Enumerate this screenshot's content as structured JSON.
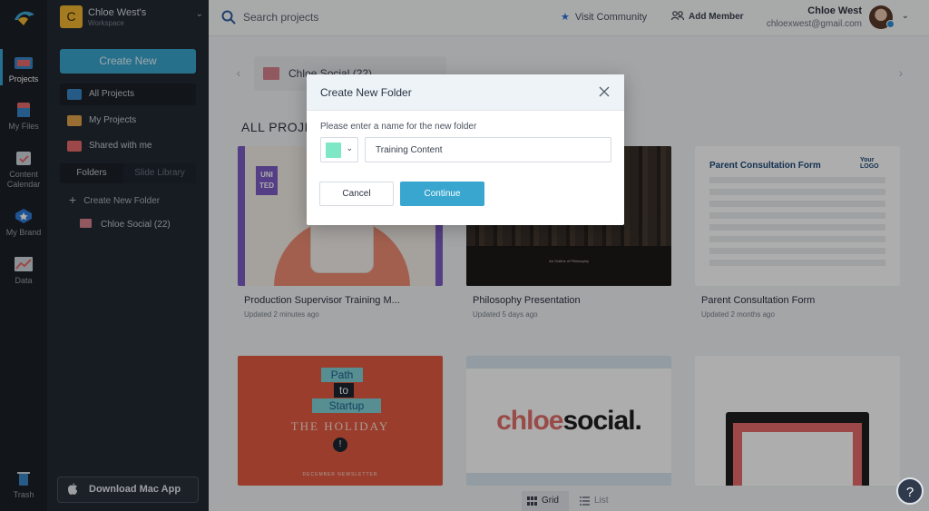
{
  "rail": {
    "items": [
      {
        "label": "Projects",
        "icon": "projects-icon"
      },
      {
        "label": "My Files",
        "icon": "files-icon"
      },
      {
        "label": "Content Calendar",
        "icon": "calendar-icon"
      },
      {
        "label": "My Brand",
        "icon": "brand-icon"
      },
      {
        "label": "Data",
        "icon": "data-icon"
      },
      {
        "label": "Trash",
        "icon": "trash-icon"
      }
    ]
  },
  "workspace": {
    "initial": "C",
    "name": "Chloe West's",
    "sub": "Workspace"
  },
  "sidebar": {
    "create_new": "Create New",
    "nav": [
      {
        "label": "All Projects"
      },
      {
        "label": "My Projects"
      },
      {
        "label": "Shared with me"
      }
    ],
    "tabs": [
      "Folders",
      "Slide Library"
    ],
    "create_folder": "Create New Folder",
    "folder": "Chloe Social (22)",
    "download_mac": "Download Mac App"
  },
  "topbar": {
    "search_placeholder": "Search projects",
    "visit_community": "Visit Community",
    "add_member": "Add Member",
    "user_name": "Chloe West",
    "user_email": "chloexwest@gmail.com"
  },
  "main": {
    "folder_chip": "Chloe Social (22)",
    "section_title": "ALL PROJEC",
    "cards": [
      {
        "title": "Production Supervisor Training M...",
        "updated": "Updated 2 minutes ago",
        "thumb_text": "UNI TED"
      },
      {
        "title": "Philosophy Presentation",
        "updated": "Updated 5 days ago",
        "thumb_text": "An Outline of Philosophy"
      },
      {
        "title": "Parent Consultation Form",
        "updated": "Updated 2 months ago",
        "thumb_text": "Parent Consultation Form",
        "thumb_logo": "Your LOGO"
      },
      {
        "title": "",
        "updated": "",
        "thumb_text_1": "Path",
        "thumb_text_2": "to",
        "thumb_text_3": "Startup",
        "thumb_text_4": "THE HOLIDAY",
        "thumb_text_5": "DECEMBER NEWSLETTER"
      },
      {
        "title": "",
        "updated": "",
        "thumb_text_a": "chloe",
        "thumb_text_b": "social."
      },
      {
        "title": "",
        "updated": ""
      }
    ],
    "view_grid": "Grid",
    "view_list": "List",
    "help": "?"
  },
  "dialog": {
    "title": "Create New Folder",
    "prompt": "Please enter a name for the new folder",
    "folder_name_value": "Training Content",
    "color": "#7ee7c5",
    "cancel": "Cancel",
    "continue": "Continue"
  },
  "colors": {
    "accent": "#38a6cf",
    "folder": "#d8828d",
    "rail_bg": "#1b1f26",
    "sidebar_bg": "#232a33"
  }
}
